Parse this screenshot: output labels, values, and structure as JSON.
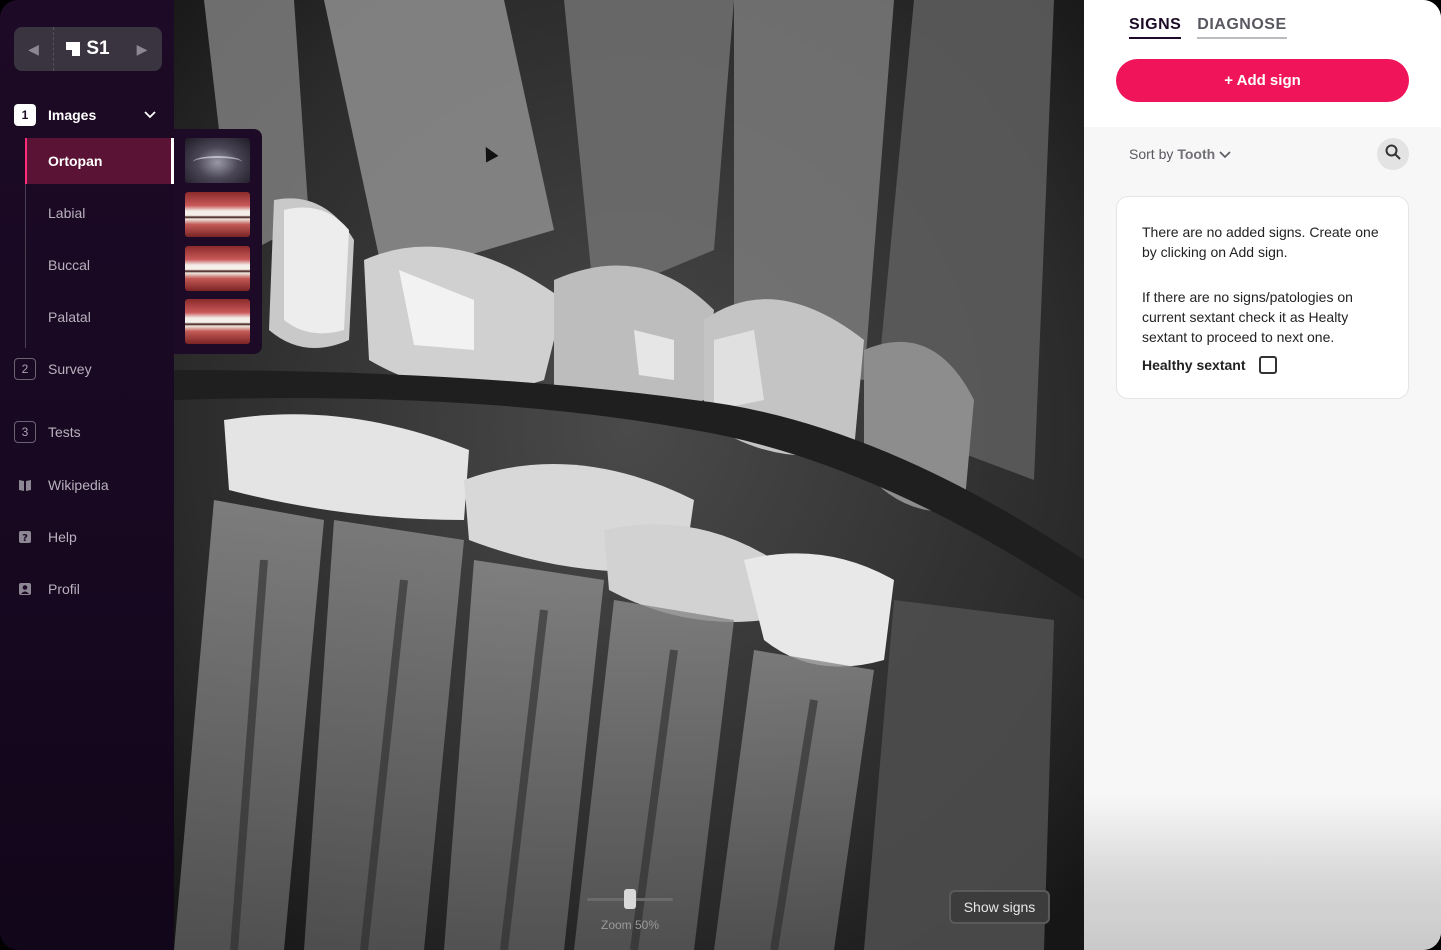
{
  "sextant_nav": {
    "label": "S1",
    "prev_icon": "chevron-left-icon",
    "next_icon": "chevron-right-icon"
  },
  "steps": [
    {
      "num": "1",
      "label": "Images"
    },
    {
      "num": "2",
      "label": "Survey"
    },
    {
      "num": "3",
      "label": "Tests"
    }
  ],
  "images": [
    {
      "label": "Ortopan"
    },
    {
      "label": "Labial"
    },
    {
      "label": "Buccal"
    },
    {
      "label": "Palatal"
    }
  ],
  "links": [
    {
      "label": "Wikipedia",
      "icon": "book-icon"
    },
    {
      "label": "Help",
      "icon": "help-icon"
    },
    {
      "label": "Profil",
      "icon": "profile-icon"
    }
  ],
  "viewer": {
    "zoom_label": "Zoom 50%",
    "zoom_level": 0.5,
    "show_signs_label": "Show signs"
  },
  "right_panel": {
    "tabs": [
      "SIGNS",
      "DIAGNOSE"
    ],
    "add_sign_label": "+ Add sign",
    "sort_prefix": "Sort by",
    "sort_value": "Tooth",
    "empty_text_1": "There are no added signs. Create one by clicking on Add sign.",
    "empty_text_2": "If there are no signs/patologies on current sextant check it as Healty sextant to proceed to next one.",
    "healthy_label": "Healthy sextant"
  },
  "colors": {
    "accent": "#f0145a",
    "sidebar_bg": "#1d0a26",
    "selected_bg": "#5a1335"
  }
}
